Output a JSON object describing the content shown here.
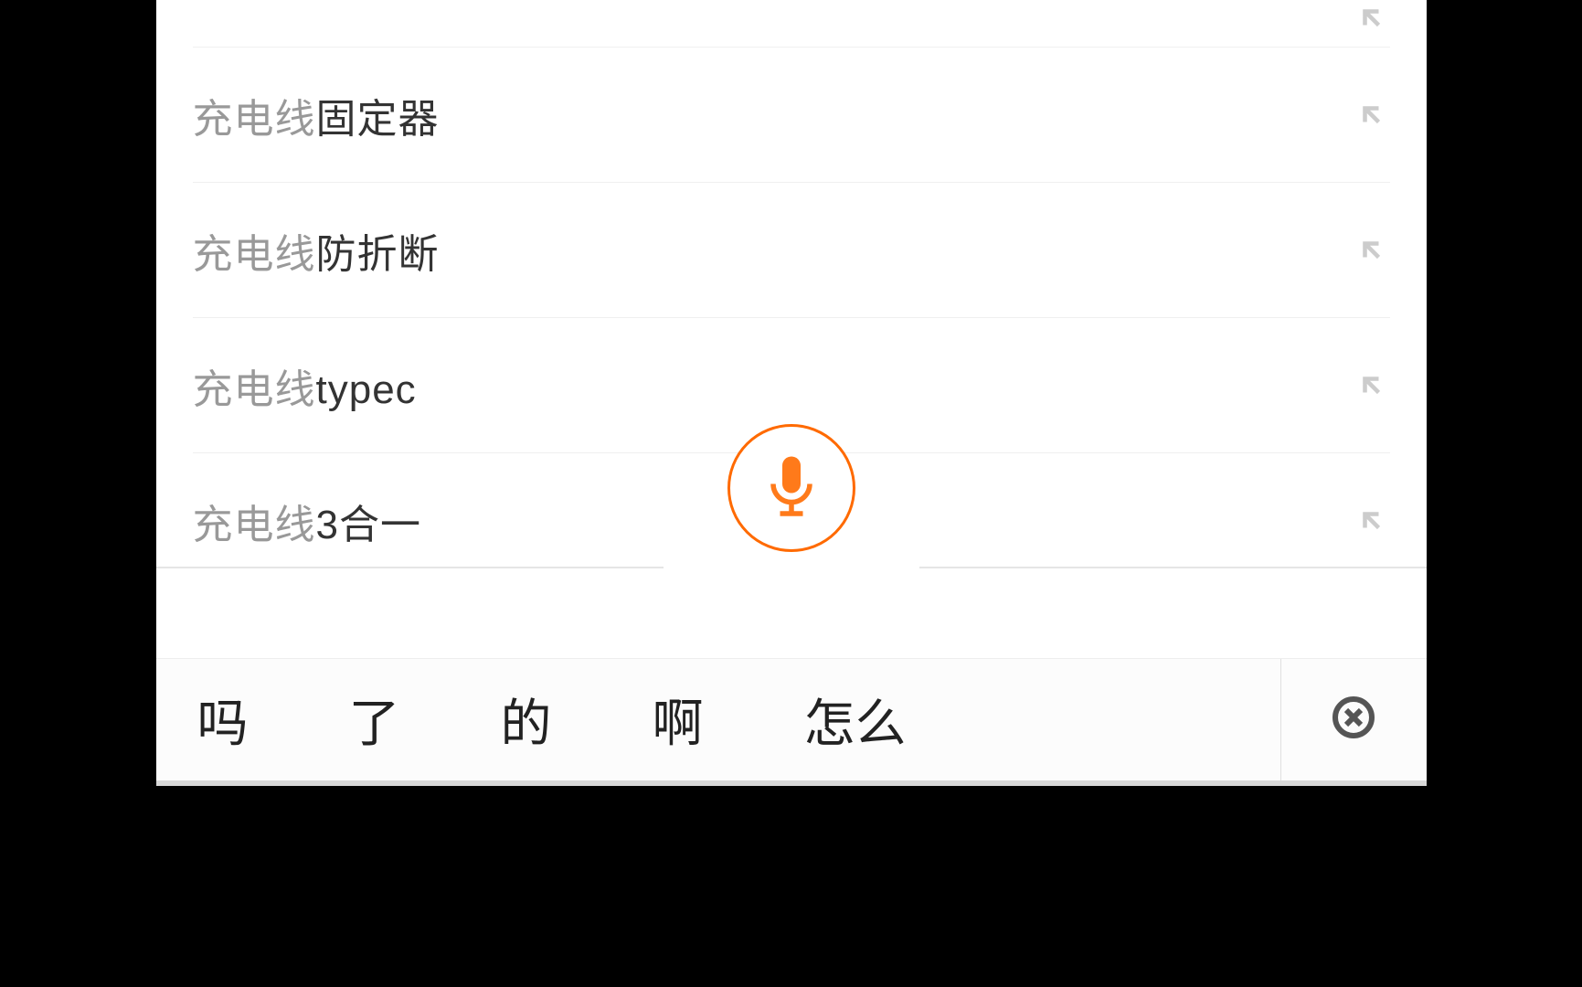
{
  "search": {
    "prefix": "充电线",
    "suggestions": [
      {
        "suffix": ""
      },
      {
        "suffix": "固定器"
      },
      {
        "suffix": "防折断"
      },
      {
        "suffix": "typec"
      },
      {
        "suffix": "3合一"
      }
    ]
  },
  "keyboard": {
    "candidates": [
      "吗",
      "了",
      "的",
      "啊",
      "怎么"
    ]
  },
  "icons": {
    "mic": "microphone-icon",
    "arrow": "arrow-up-left-icon",
    "close": "close-circle-icon"
  },
  "colors": {
    "accent": "#ff6a00",
    "prefix": "#999999",
    "suffix": "#333333"
  }
}
